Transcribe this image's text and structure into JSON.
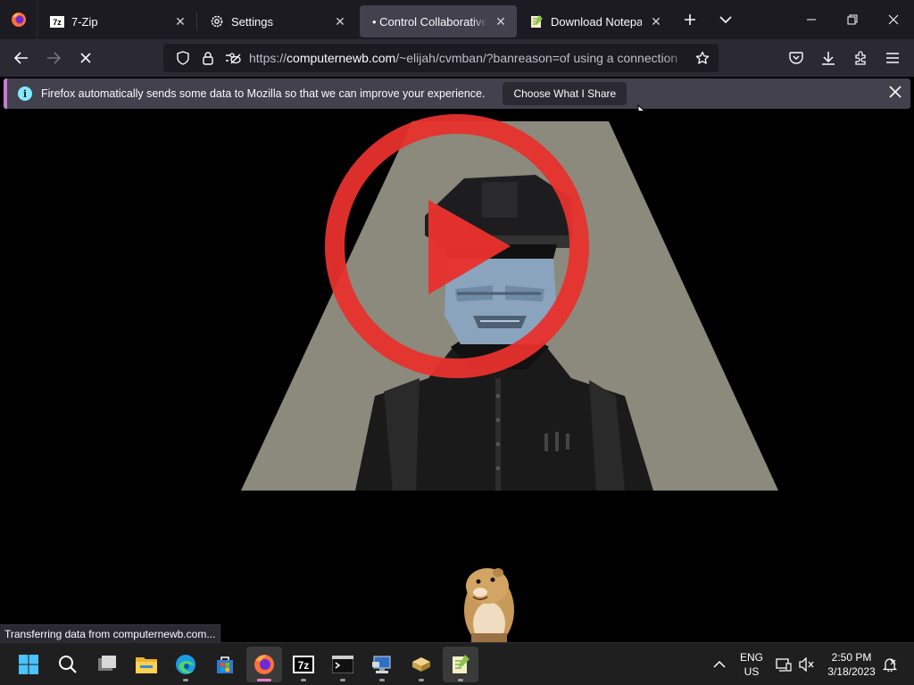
{
  "browser": {
    "tabs": [
      {
        "label": "7-Zip",
        "icon": "7zip-icon"
      },
      {
        "label": "Settings",
        "icon": "gear-icon"
      },
      {
        "label": "• Control Collaborative W",
        "icon": "none",
        "active": true
      },
      {
        "label": "Download Notepad++",
        "icon": "notepad-plus-plus-icon"
      }
    ],
    "url_host": "computernewb.com",
    "url_prefix": "https://",
    "url_path": "/~elijah/cvmban/?banreason=of using a connection",
    "notification": {
      "message": "Firefox automatically sends some data to Mozilla so that we can improve your experience.",
      "button": "Choose What I Share"
    },
    "status_text": "Transferring data from computernewb.com..."
  },
  "colors": {
    "accent": "#c77bd8",
    "play_red": "#e8322d",
    "spotlight": "#8b8a7d",
    "face_blue": "#8aa4bd"
  },
  "taskbar": {
    "items": [
      "windows-start-icon",
      "search-icon",
      "task-view-icon",
      "file-explorer-icon",
      "edge-icon",
      "store-icon",
      "firefox-icon",
      "7zip-icon",
      "terminal-icon",
      "remote-desktop-icon",
      "archive-icon",
      "notepad-plus-plus-icon"
    ],
    "lang_line1": "ENG",
    "lang_line2": "US",
    "time": "2:50 PM",
    "date": "3/18/2023"
  }
}
